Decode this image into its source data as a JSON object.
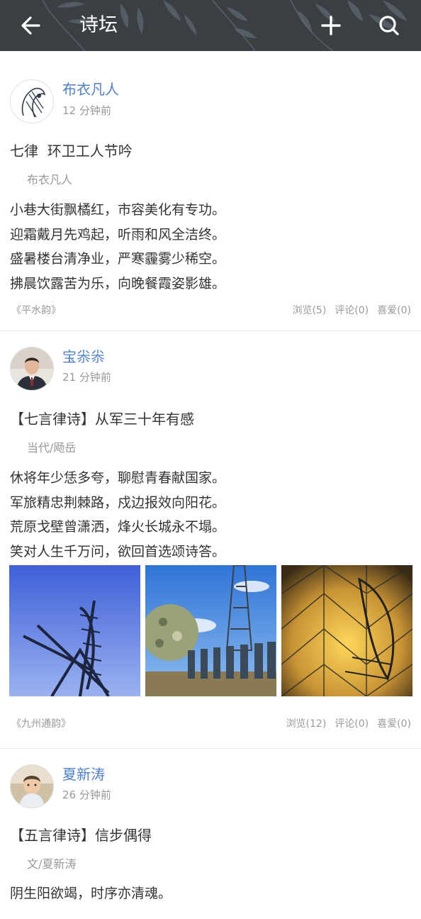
{
  "header": {
    "title": "诗坛",
    "back_icon": "arrow-left-icon",
    "add_icon": "plus-icon",
    "search_icon": "search-icon",
    "background_color": "#3b3f44"
  },
  "posts": [
    {
      "author": "布衣凡人",
      "time": "12 分钟前",
      "title": "七律  环卫工人节吟",
      "byline": "布衣凡人",
      "lines": [
        "小巷大街飘橘红，市容美化有专功。",
        "迎霜戴月先鸡起，听雨和风全洁终。",
        "盛暑楼台清净业，严寒霾雾少稀空。",
        "拂晨饮露苦为乐，向晚餐霞姿影雄。"
      ],
      "rhyme": "《平水韵》",
      "views": "浏览(5)",
      "comments": "评论(0)",
      "likes": "喜爱(0)"
    },
    {
      "author": "宝尜尜",
      "time": "21 分钟前",
      "title": "【七言律诗】从军三十年有感",
      "byline": "当代/飏岳",
      "lines": [
        "休将年少恁多夸，聊慰青春献国家。",
        "军旅精忠荆棘路，戍边报效向阳花。",
        "荒原戈壁曾潇洒，烽火长城永不塌。",
        "笑对人生千万问，欲回首选颂诗答。"
      ],
      "rhyme": "《九州通韵》",
      "views": "浏览(12)",
      "comments": "评论(0)",
      "likes": "喜爱(0)"
    },
    {
      "author": "夏新涛",
      "time": "26 分钟前",
      "title": "【五言律诗】信步偶得",
      "byline": "文/夏新涛",
      "lines": [
        "阴生阳欲竭，时序亦清魂。"
      ]
    }
  ],
  "colors": {
    "accent": "#4f7fc4",
    "muted": "#999999",
    "text": "#333333"
  }
}
